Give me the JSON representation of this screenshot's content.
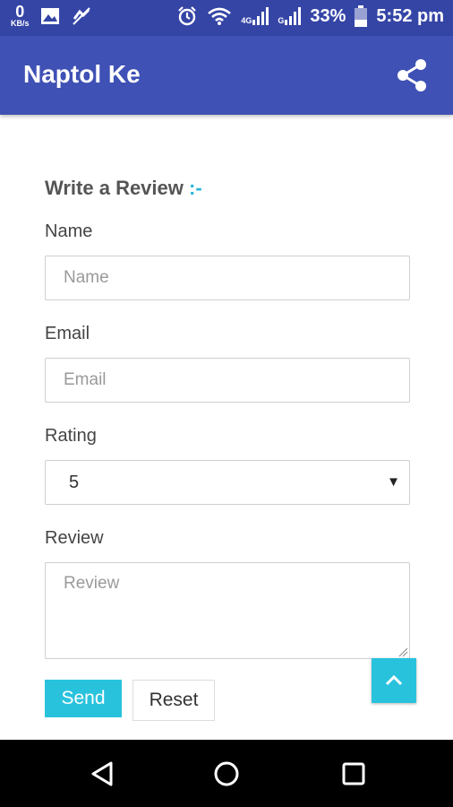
{
  "status": {
    "kbs_value": "0",
    "kbs_unit": "KB/s",
    "net1": "4G",
    "net2": "G",
    "battery": "33%",
    "time": "5:52 pm"
  },
  "appbar": {
    "title": "Naptol Ke",
    "share_icon": "share-icon"
  },
  "form": {
    "heading": "Write a Review",
    "heading_suffix": " :-",
    "name_label": "Name",
    "name_placeholder": "Name",
    "email_label": "Email",
    "email_placeholder": "Email",
    "rating_label": "Rating",
    "rating_value": "5",
    "review_label": "Review",
    "review_placeholder": "Review",
    "send_label": "Send",
    "reset_label": "Reset"
  },
  "colors": {
    "appbar": "#3f51b5",
    "statusbar": "#3545a6",
    "accent": "#29c2dd"
  }
}
